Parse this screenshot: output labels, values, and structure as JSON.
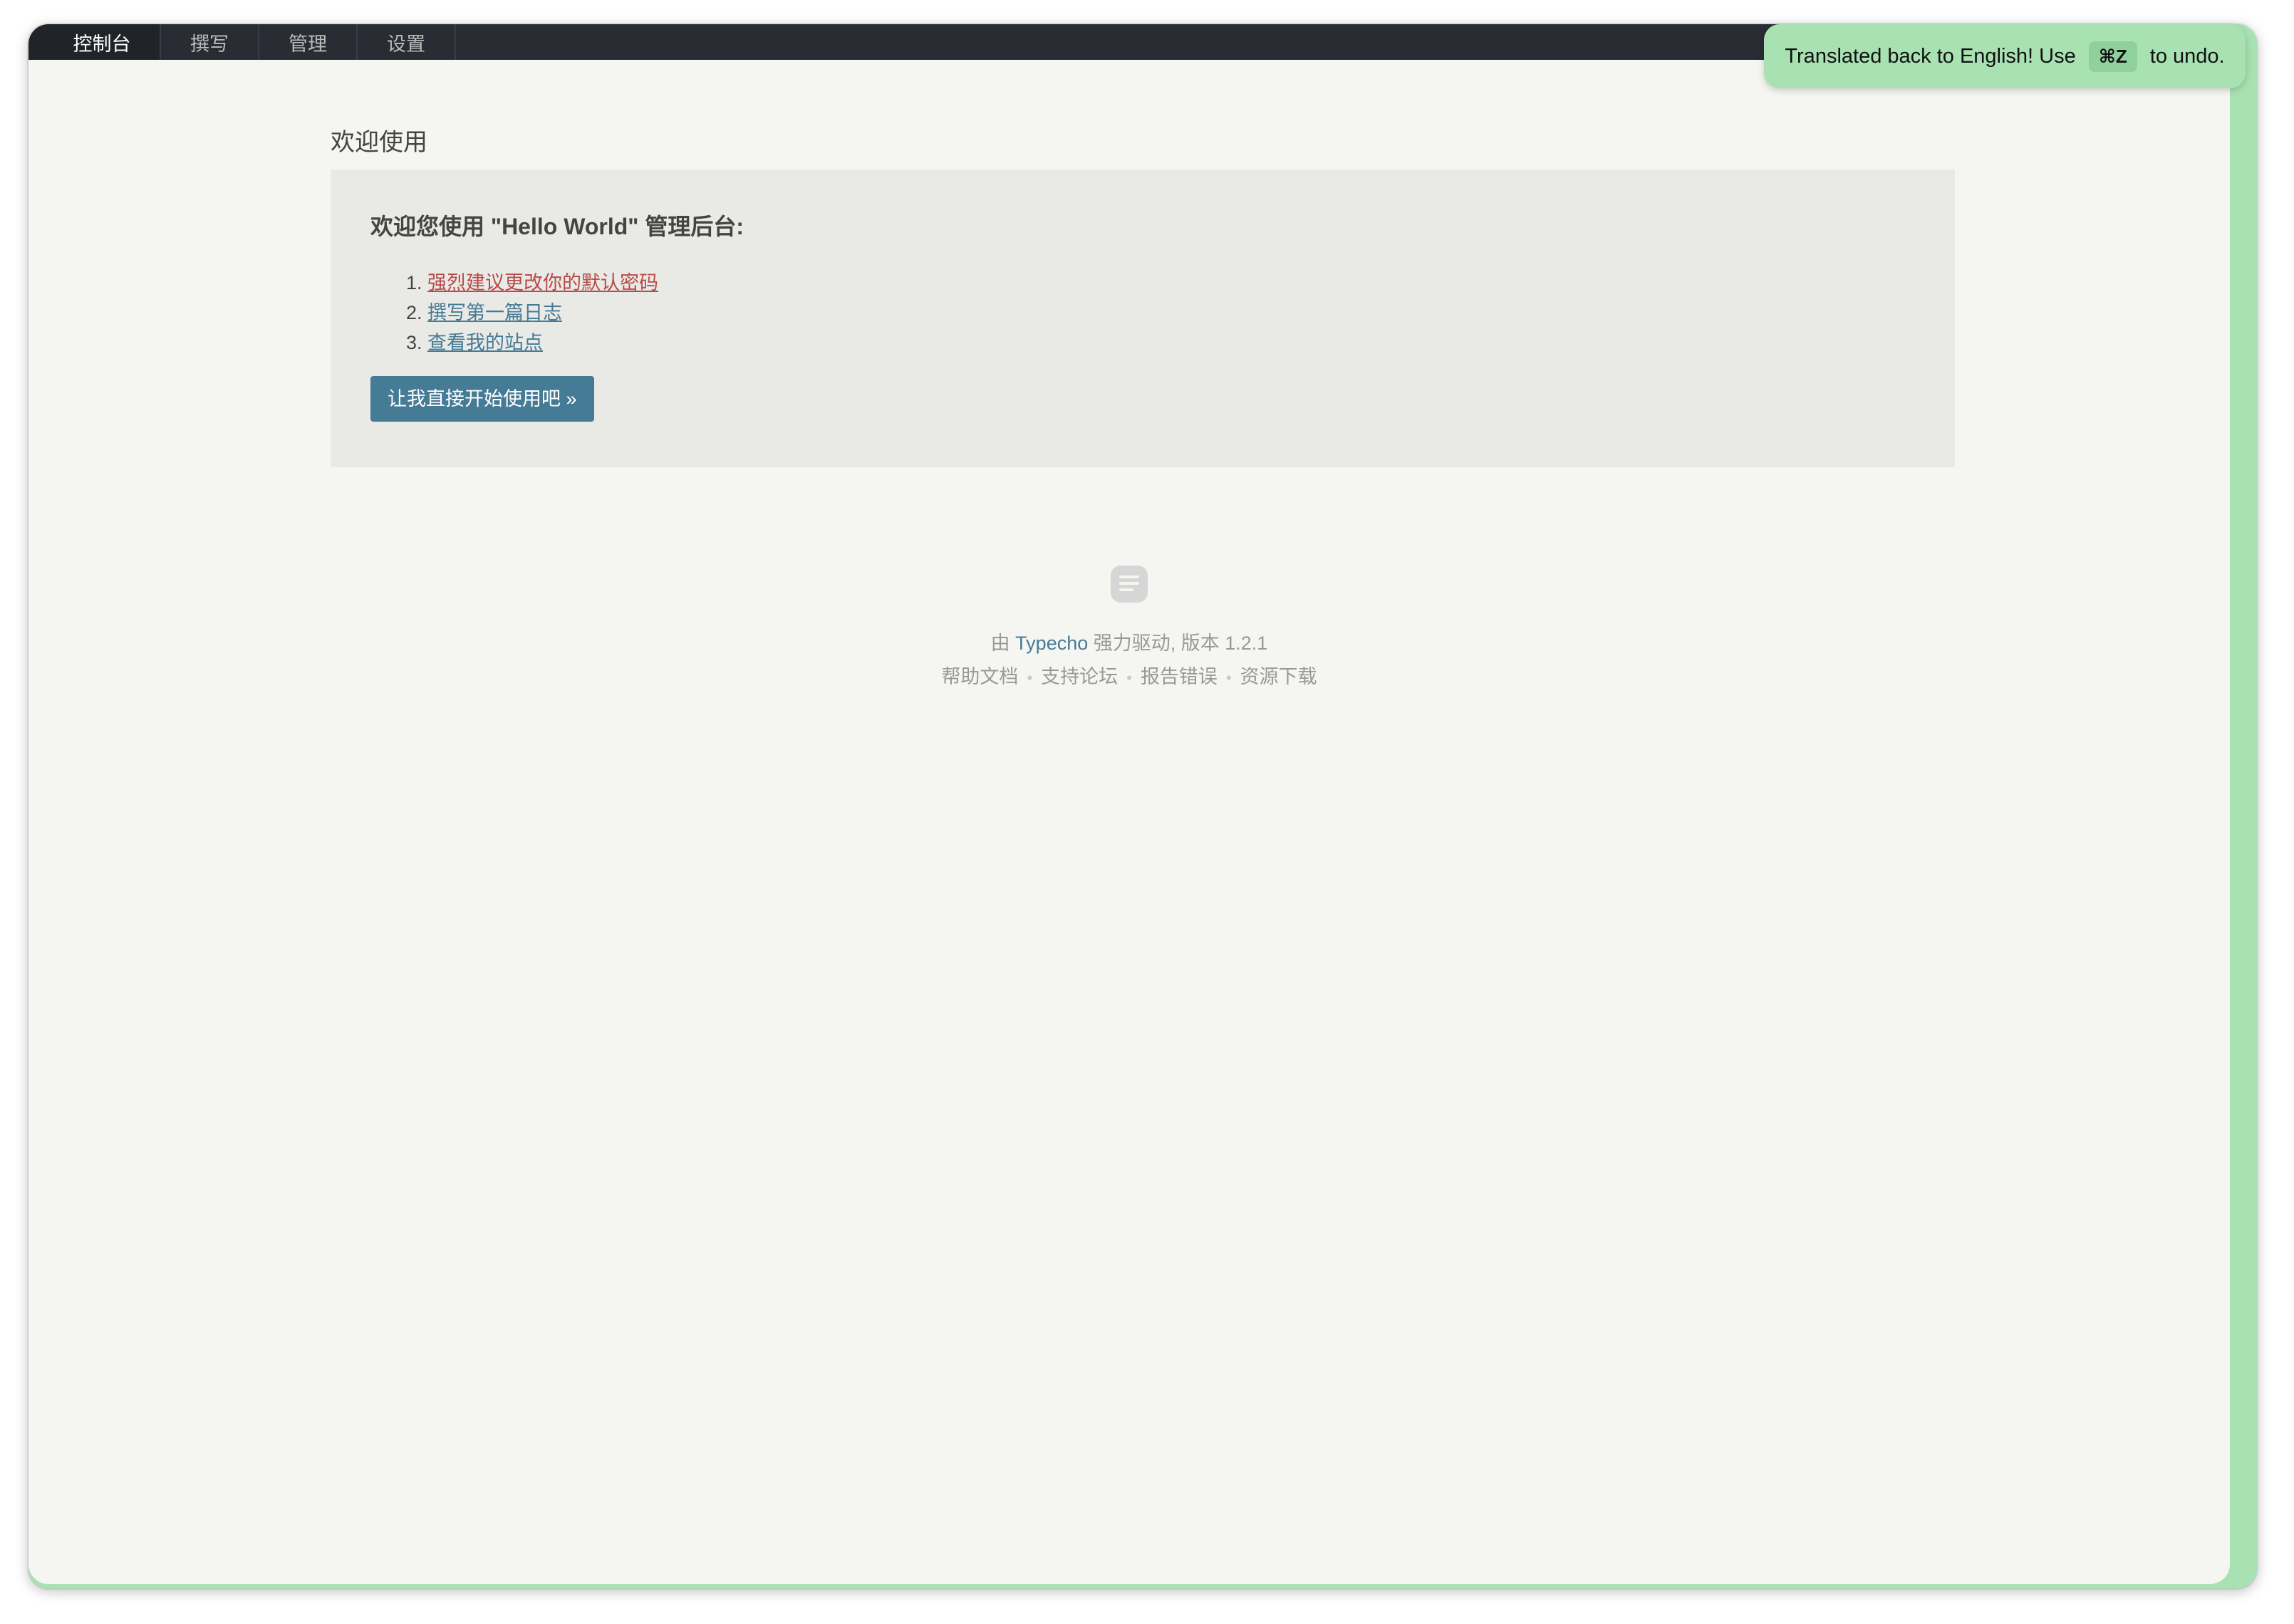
{
  "nav": {
    "items": [
      {
        "label": "控制台",
        "active": true
      },
      {
        "label": "撰写",
        "active": false
      },
      {
        "label": "管理",
        "active": false
      },
      {
        "label": "设置",
        "active": false
      }
    ]
  },
  "main": {
    "page_title": "欢迎使用",
    "welcome_heading": "欢迎您使用 \"Hello World\" 管理后台:",
    "steps": [
      "强烈建议更改你的默认密码",
      "撰写第一篇日志",
      "查看我的站点"
    ],
    "start_button": "让我直接开始使用吧 »"
  },
  "footer": {
    "powered_prefix": "由",
    "powered_link": "Typecho",
    "powered_suffix": "强力驱动, 版本 1.2.1",
    "links": [
      "帮助文档",
      "支持论坛",
      "报告错误",
      "资源下载"
    ],
    "separator": "•"
  },
  "toast": {
    "text_before": "Translated back to English! Use",
    "shortcut": "⌘Z",
    "text_after": "to undo."
  },
  "colors": {
    "nav_background": "#292d33",
    "link_blue": "#467b96",
    "warning_red": "#b94a48",
    "toast_green": "#a8e2b2"
  },
  "icons": {
    "footer_logo": "typecho-logo-icon"
  }
}
